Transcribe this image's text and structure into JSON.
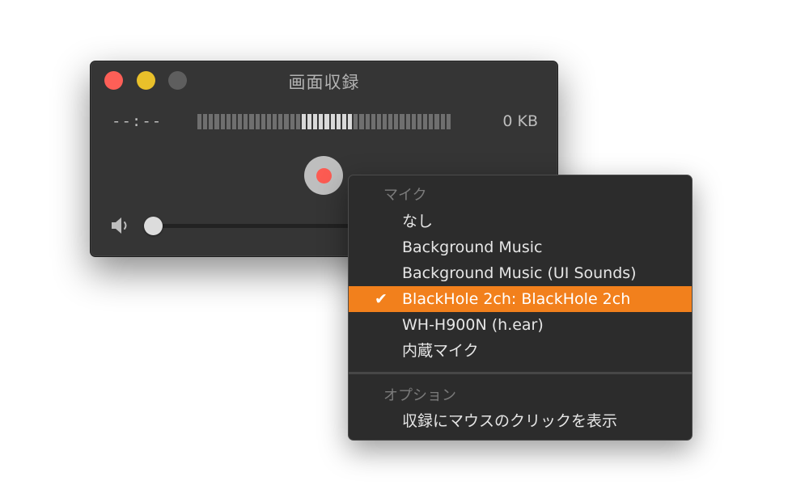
{
  "window": {
    "title": "画面収録",
    "timer": "--:--",
    "file_size": "0 KB",
    "level_meter": {
      "segments": 44,
      "active_from": 18,
      "active_to": 26
    },
    "volume_level": 0
  },
  "menu": {
    "mic_header": "マイク",
    "mic_items": [
      {
        "label": "なし",
        "selected": false
      },
      {
        "label": "Background Music",
        "selected": false
      },
      {
        "label": "Background Music (UI Sounds)",
        "selected": false
      },
      {
        "label": "BlackHole 2ch: BlackHole 2ch",
        "selected": true
      },
      {
        "label": "WH-H900N (h.ear)",
        "selected": false
      },
      {
        "label": "内蔵マイク",
        "selected": false
      }
    ],
    "check_glyph": "✔",
    "options_header": "オプション",
    "option_items": [
      {
        "label": "収録にマウスのクリックを表示",
        "selected": false
      }
    ]
  },
  "colors": {
    "accent": "#f2801c",
    "close": "#fd5f57",
    "minimize": "#e9c02a",
    "record": "#fc5b52"
  }
}
